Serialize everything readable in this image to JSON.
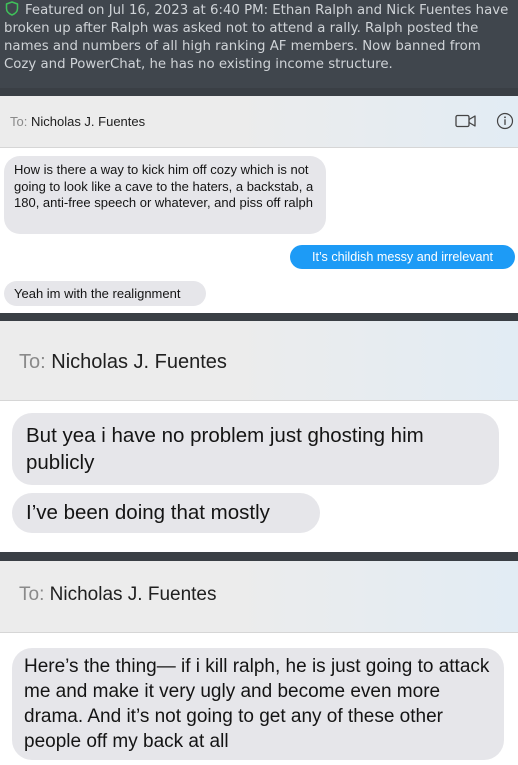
{
  "banner": {
    "icon": "shield-icon",
    "text": "Featured on Jul 16, 2023 at 6:40 PM: Ethan Ralph and Nick Fuentes have broken up after Ralph was asked not to attend a rally. Ralph posted the names and numbers of all high ranking AF members. Now banned from Cozy and PowerChat, he has no existing income structure."
  },
  "screenshots": [
    {
      "to_label": "To:",
      "recipient": "Nicholas J. Fuentes",
      "icons": [
        "video-call-icon",
        "info-icon"
      ],
      "messages": [
        {
          "side": "received",
          "text": "How is there a way to kick him off cozy which is not going to look like a cave to the haters, a backstab, a 180, anti-free speech or whatever, and piss off ralph"
        },
        {
          "side": "sent",
          "text": "It’s childish messy and irrelevant"
        },
        {
          "side": "received",
          "text": "Yeah im with the realignment"
        }
      ]
    },
    {
      "to_label": "To:",
      "recipient": "Nicholas J. Fuentes",
      "messages": [
        {
          "side": "received",
          "text": "But yea i have no problem just ghosting him publicly"
        },
        {
          "side": "received",
          "text": "I’ve been doing that mostly"
        }
      ]
    },
    {
      "to_label": "To:",
      "recipient": "Nicholas J. Fuentes",
      "messages": [
        {
          "side": "received",
          "text": "Here’s the thing— if i kill ralph, he is just going to attack me and make it very ugly and become even more drama. And it’s not going to get any of these other people off my back at all"
        }
      ]
    }
  ],
  "colors": {
    "background": "#3a3f45",
    "banner_bg": "#40464d",
    "banner_text": "#cfd3d7",
    "shield": "#3fc15a",
    "sent_bubble": "#1d9bf6",
    "received_bubble": "#e6e6ea"
  }
}
